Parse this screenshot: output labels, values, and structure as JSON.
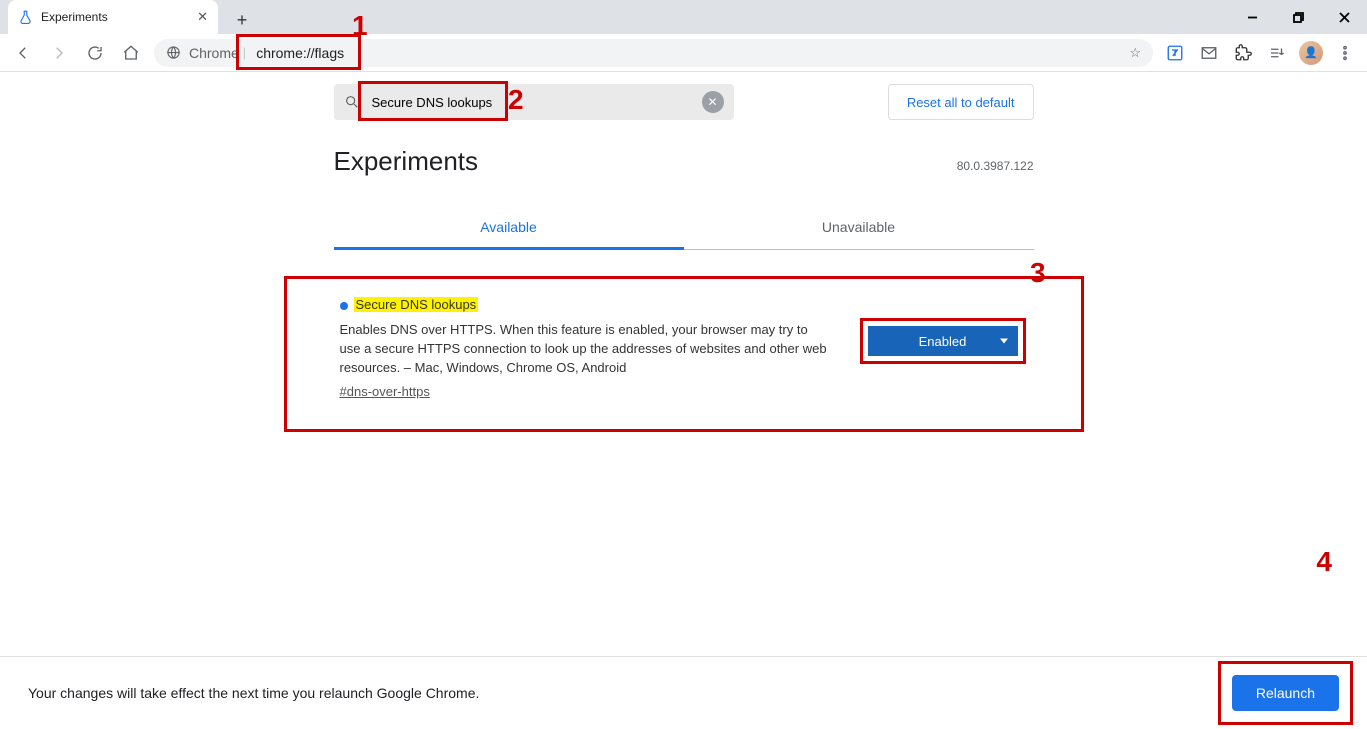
{
  "browser": {
    "tab_title": "Experiments",
    "url_origin": "Chrome",
    "url_path": "chrome://flags"
  },
  "search": {
    "query": "Secure DNS lookups"
  },
  "controls": {
    "reset_label": "Reset all to default",
    "relaunch_label": "Relaunch"
  },
  "header": {
    "title": "Experiments",
    "version": "80.0.3987.122"
  },
  "tabs": {
    "available": "Available",
    "unavailable": "Unavailable"
  },
  "flag": {
    "title": "Secure DNS lookups",
    "description": "Enables DNS over HTTPS. When this feature is enabled, your browser may try to use a secure HTTPS connection to look up the addresses of websites and other web resources. – Mac, Windows, Chrome OS, Android",
    "hash": "#dns-over-https",
    "state": "Enabled"
  },
  "restart": {
    "message": "Your changes will take effect the next time you relaunch Google Chrome."
  },
  "callouts": {
    "n1": "1",
    "n2": "2",
    "n3": "3",
    "n4": "4"
  }
}
